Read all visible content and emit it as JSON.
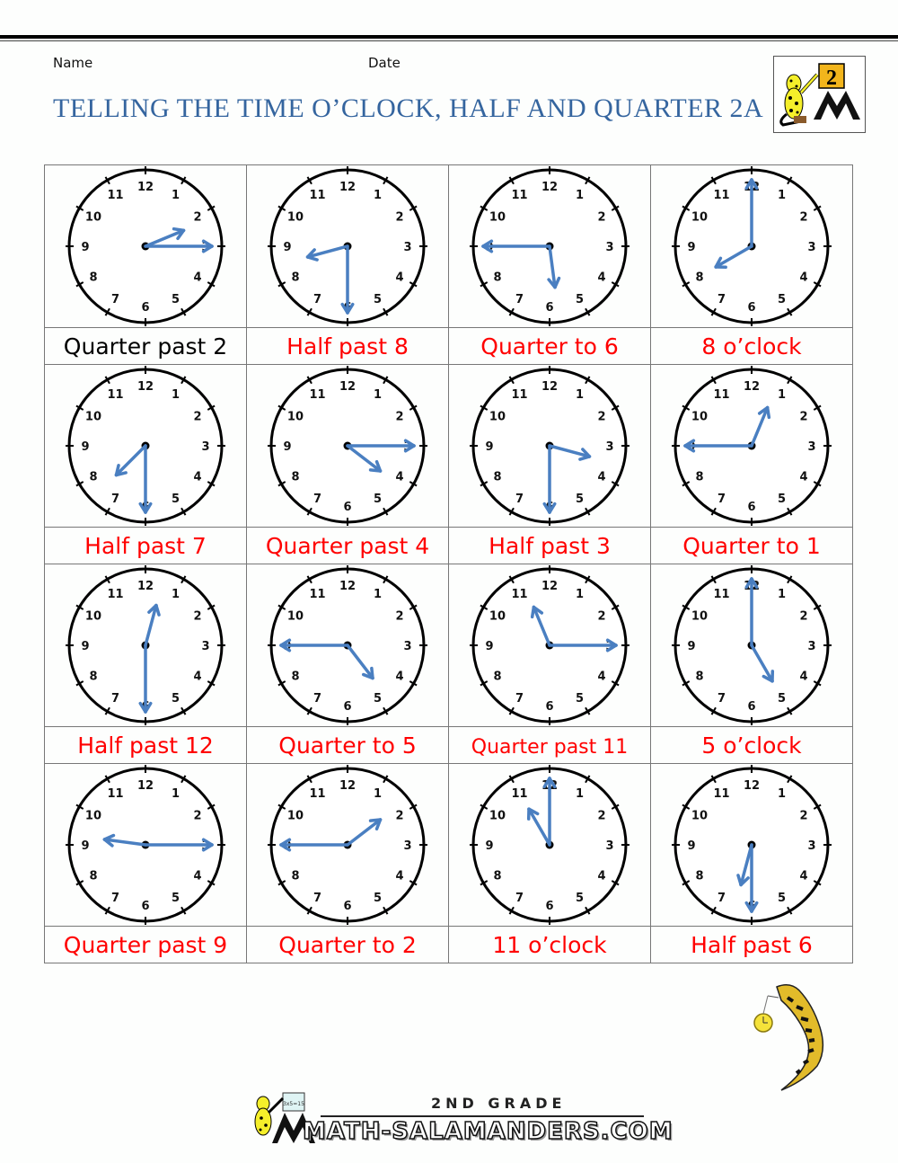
{
  "header": {
    "name_label": "Name",
    "date_label": "Date",
    "title": "TELLING THE TIME O’CLOCK, HALF AND QUARTER 2A",
    "grade_badge": "2"
  },
  "colors": {
    "title": "#35659f",
    "hand": "#4a7fc1",
    "answer": "#ff0000",
    "example_caption": "#000000"
  },
  "clock_numbers": [
    "12",
    "1",
    "2",
    "3",
    "4",
    "5",
    "6",
    "7",
    "8",
    "9",
    "10",
    "11"
  ],
  "clocks": [
    {
      "caption": "Quarter past 2",
      "hour": 2,
      "minute": 15,
      "example": true
    },
    {
      "caption": "Half past 8",
      "hour": 8,
      "minute": 30,
      "example": false
    },
    {
      "caption": "Quarter to 6",
      "hour": 5,
      "minute": 45,
      "example": false
    },
    {
      "caption": "8 o’clock",
      "hour": 8,
      "minute": 0,
      "example": false
    },
    {
      "caption": "Half past 7",
      "hour": 7,
      "minute": 30,
      "example": false
    },
    {
      "caption": "Quarter past 4",
      "hour": 4,
      "minute": 15,
      "example": false
    },
    {
      "caption": "Half past 3",
      "hour": 3,
      "minute": 30,
      "example": false
    },
    {
      "caption": "Quarter to 1",
      "hour": 12,
      "minute": 45,
      "example": false
    },
    {
      "caption": "Half past 12",
      "hour": 12,
      "minute": 30,
      "example": false
    },
    {
      "caption": "Quarter to 5",
      "hour": 4,
      "minute": 45,
      "example": false
    },
    {
      "caption": "Quarter past 11",
      "hour": 11,
      "minute": 15,
      "example": false
    },
    {
      "caption": "5 o’clock",
      "hour": 5,
      "minute": 0,
      "example": false
    },
    {
      "caption": "Quarter past 9",
      "hour": 9,
      "minute": 15,
      "example": false
    },
    {
      "caption": "Quarter to 2",
      "hour": 1,
      "minute": 45,
      "example": false
    },
    {
      "caption": "11 o’clock",
      "hour": 11,
      "minute": 0,
      "example": false
    },
    {
      "caption": "Half past 6",
      "hour": 6,
      "minute": 30,
      "example": false
    }
  ],
  "footer": {
    "grade": "2ND GRADE",
    "site": "MATH-SALAMANDERS.COM",
    "board_text": "3x5=15"
  }
}
